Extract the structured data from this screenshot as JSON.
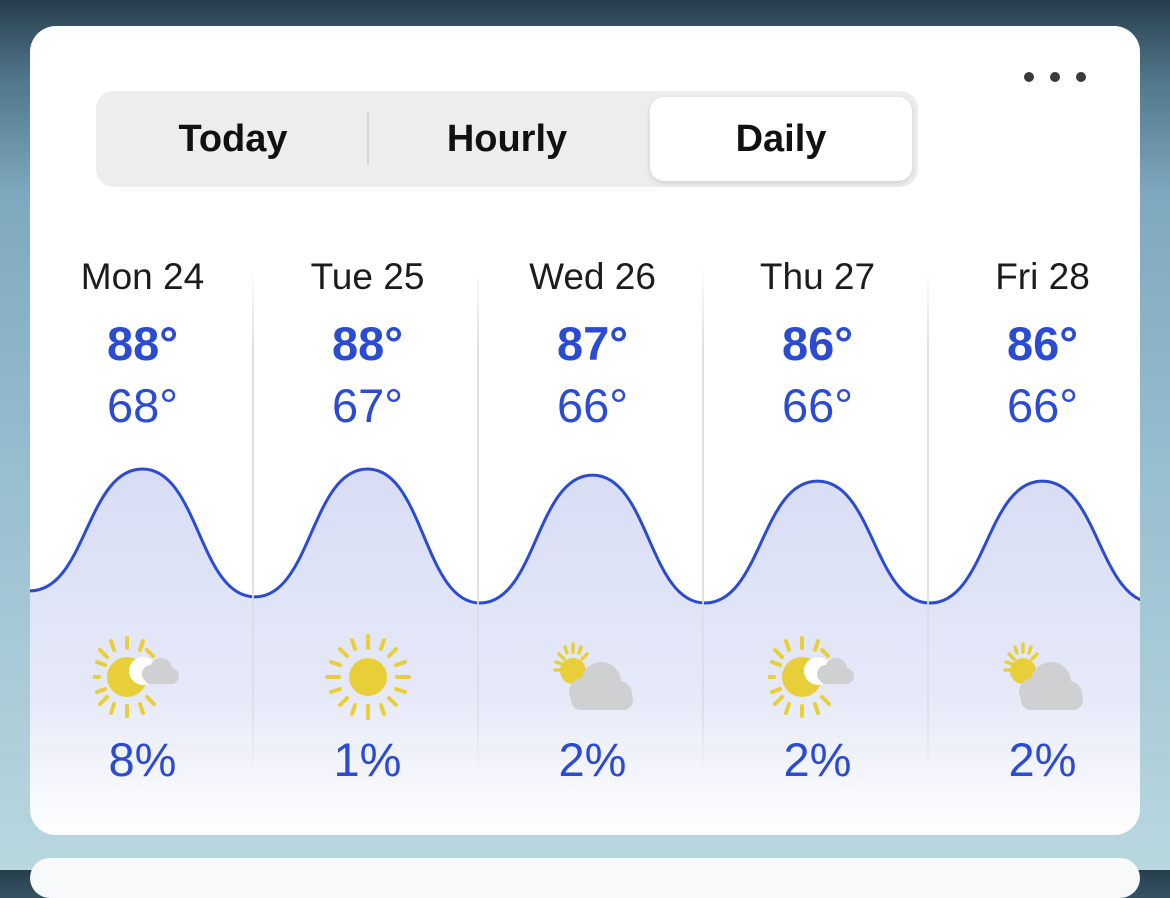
{
  "segmented": {
    "options": [
      "Today",
      "Hourly",
      "Daily"
    ],
    "selected": "Daily"
  },
  "colors": {
    "accent": "#2b4bd3",
    "curve_fill": "#dfe3f6",
    "sun": "#e8cf3a",
    "cloud": "#cfd0d2"
  },
  "days": [
    {
      "label": "Mon 24",
      "high": "88°",
      "low": "68°",
      "precip": "8%",
      "icon": "sun-cloud-icon"
    },
    {
      "label": "Tue 25",
      "high": "88°",
      "low": "67°",
      "precip": "1%",
      "icon": "sun-icon"
    },
    {
      "label": "Wed 26",
      "high": "87°",
      "low": "66°",
      "precip": "2%",
      "icon": "cloud-sun-icon"
    },
    {
      "label": "Thu 27",
      "high": "86°",
      "low": "66°",
      "precip": "2%",
      "icon": "sun-cloud-icon"
    },
    {
      "label": "Fri 28",
      "high": "86°",
      "low": "66°",
      "precip": "2%",
      "icon": "cloud-sun-icon"
    }
  ],
  "chart_data": {
    "type": "line",
    "categories": [
      "Mon 24",
      "Tue 25",
      "Wed 26",
      "Thu 27",
      "Fri 28"
    ],
    "series": [
      {
        "values": [
          88,
          88,
          87,
          86,
          86
        ]
      },
      {
        "values": [
          68,
          67,
          66,
          66,
          66
        ]
      }
    ]
  }
}
